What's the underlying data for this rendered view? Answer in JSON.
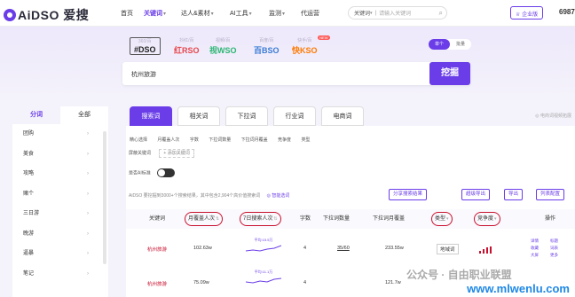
{
  "app": {
    "logo": "AiDSO 爱搜",
    "enterprise_label": "企业版",
    "enterprise_num": "6987"
  },
  "nav": {
    "items": [
      {
        "label": "首页",
        "active": false
      },
      {
        "label": "关键词",
        "active": true
      },
      {
        "label": "达人&素材",
        "active": false
      },
      {
        "label": "AI工具",
        "active": false
      },
      {
        "label": "监测",
        "active": false
      },
      {
        "label": "代运营",
        "active": false
      }
    ],
    "search_scope": "关键词",
    "search_placeholder": "请输入关键词"
  },
  "engines": [
    {
      "caption": "360/百",
      "name": "#DSO",
      "color": "#222222",
      "selected": true,
      "hot": ""
    },
    {
      "caption": "抖红/百",
      "name": "红RSO",
      "color": "#e5484d",
      "selected": false,
      "hot": ""
    },
    {
      "caption": "视频/百",
      "name": "视WSO",
      "color": "#2bb673",
      "selected": false,
      "hot": ""
    },
    {
      "caption": "百度/百",
      "name": "百BSO",
      "color": "#3a7bd5",
      "selected": false,
      "hot": ""
    },
    {
      "caption": "快手/百",
      "name": "快KSO",
      "color": "#ff7a00",
      "selected": false,
      "hot": "NEW"
    }
  ],
  "mode_toggle": [
    "单个",
    "批量"
  ],
  "search": {
    "value": "杭州旅游",
    "button": "挖掘"
  },
  "left_panel": {
    "tabs": [
      "分词",
      "全部"
    ],
    "items": [
      "团购",
      "美食",
      "攻略",
      "赌个",
      "三日游",
      "晚游",
      "逼暴",
      "笔记"
    ]
  },
  "main": {
    "tabs": [
      "搜索词",
      "相关词",
      "下拉词",
      "行业词",
      "电商词"
    ],
    "growth_text": "◎ 电商词视频拓展",
    "filters": [
      "精心选择",
      "月覆盖人次",
      "字数",
      "下拉词数量",
      "下拉词月覆盖",
      "竞争度",
      "类型"
    ],
    "chip_label": "屏蔽关键词",
    "chip_add": "+ 添加关键词",
    "ai_label": "是否AI标准",
    "result_count": "AiDSO 要挖掘到3000+个搜索结果，其中包含2,904个高价值搜索词",
    "smart_label": "◎ 智能选词",
    "actions": [
      "分享搜索结果",
      "超级导出",
      "导出",
      "列表配置"
    ],
    "headers": [
      "关键词",
      "月覆盖人次",
      "7日搜索人次",
      "字数",
      "下拉词数量",
      "下拉词月覆盖",
      "类型",
      "竞争度",
      "操作"
    ],
    "rows": [
      {
        "keyword": "杭州旅游",
        "monthly": "102.63w",
        "trend_label": "平均:15.5万",
        "chars": "4",
        "dropdown": "35/60",
        "dropdown_monthly": "233.55w",
        "type": "地域词"
      },
      {
        "keyword": "杭州旅游",
        "monthly": "75.09w",
        "trend_label": "平均:11.1万",
        "chars": "4",
        "dropdown": "",
        "dropdown_monthly": "121.7w",
        "type": ""
      }
    ],
    "ops": [
      "详情",
      "标题",
      "收藏",
      "词表",
      "大屏",
      "更多"
    ]
  },
  "watermark": {
    "text": "公众号 · 自由职业联盟",
    "url": "www.mlwenlu.com"
  },
  "colors": {
    "accent": "#6a3de8",
    "keyword_red": "#c8102e"
  }
}
